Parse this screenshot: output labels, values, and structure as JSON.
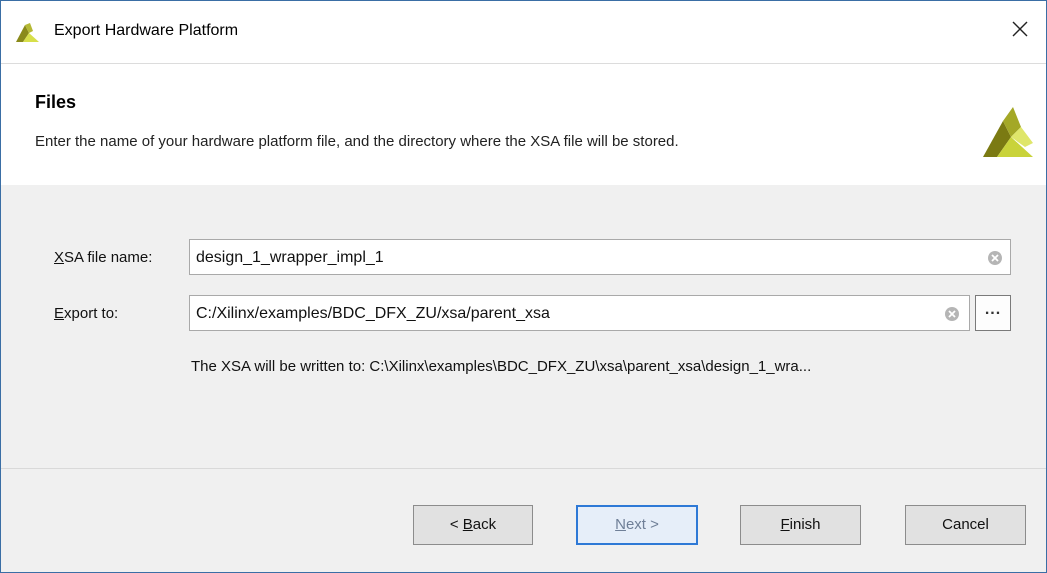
{
  "window": {
    "title": "Export Hardware Platform",
    "close_glyph": "✕"
  },
  "header": {
    "title": "Files",
    "description": "Enter the name of your hardware platform file, and the directory where the XSA file will be stored."
  },
  "form": {
    "xsa_label_mnemonic": "X",
    "xsa_label_rest": "SA file name:",
    "xsa_value": "design_1_wrapper_impl_1",
    "export_label_mnemonic": "E",
    "export_label_rest": "xport to:",
    "export_value": "C:/Xilinx/examples/BDC_DFX_ZU/xsa/parent_xsa",
    "browse_label": "...",
    "path_info": "The XSA will be written to: C:\\Xilinx\\examples\\BDC_DFX_ZU\\xsa\\parent_xsa\\design_1_wra..."
  },
  "buttons": {
    "back_prefix": "< ",
    "back_mnemonic": "B",
    "back_rest": "ack",
    "next_mnemonic": "N",
    "next_rest": "ext >",
    "finish_mnemonic": "F",
    "finish_rest": "inish",
    "cancel": "Cancel"
  },
  "colors": {
    "accent_focus": "#2e79d6",
    "logo_dark": "#7b7a12",
    "logo_light": "#c9d33a"
  },
  "icons": [
    "vivado-logo-icon",
    "close-icon",
    "clear-icon",
    "browse-icon"
  ]
}
